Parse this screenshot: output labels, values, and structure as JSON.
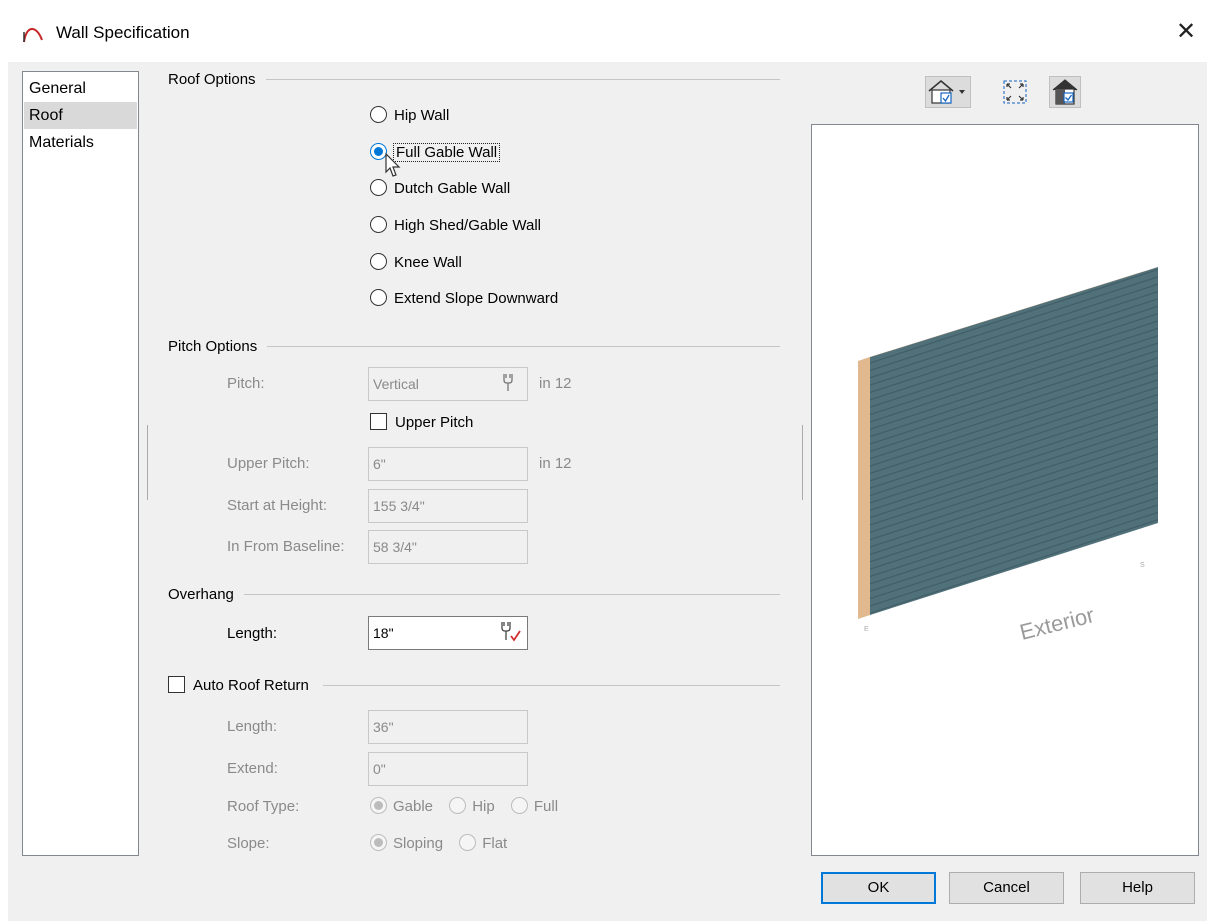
{
  "window": {
    "title": "Wall Specification",
    "close_glyph": "✕"
  },
  "nav": {
    "items": [
      {
        "label": "General",
        "selected": false
      },
      {
        "label": "Roof",
        "selected": true
      },
      {
        "label": "Materials",
        "selected": false
      }
    ]
  },
  "roof_options": {
    "title": "Roof Options",
    "options": [
      {
        "label": "Hip Wall",
        "checked": false
      },
      {
        "label": "Full Gable Wall",
        "checked": true
      },
      {
        "label": "Dutch Gable Wall",
        "checked": false
      },
      {
        "label": "High Shed/Gable Wall",
        "checked": false
      },
      {
        "label": "Knee Wall",
        "checked": false
      },
      {
        "label": "Extend Slope Downward",
        "checked": false
      }
    ]
  },
  "pitch_options": {
    "title": "Pitch Options",
    "pitch_label": "Pitch:",
    "pitch_value": "Vertical",
    "pitch_unit": "in 12",
    "upper_pitch_checkbox": "Upper Pitch",
    "upper_pitch_label": "Upper Pitch:",
    "upper_pitch_value": "6\"",
    "upper_pitch_unit": "in 12",
    "start_height_label": "Start at Height:",
    "start_height_value": "155 3/4\"",
    "in_from_baseline_label": "In From Baseline:",
    "in_from_baseline_value": "58 3/4\""
  },
  "overhang": {
    "title": "Overhang",
    "length_label": "Length:",
    "length_value": "18\""
  },
  "auto_roof_return": {
    "title": "Auto Roof Return",
    "length_label": "Length:",
    "length_value": "36\"",
    "extend_label": "Extend:",
    "extend_value": "0\"",
    "roof_type_label": "Roof Type:",
    "roof_type_options": [
      "Gable",
      "Hip",
      "Full"
    ],
    "slope_label": "Slope:",
    "slope_options": [
      "Sloping",
      "Flat"
    ]
  },
  "preview": {
    "label": "Exterior"
  },
  "buttons": {
    "ok": "OK",
    "cancel": "Cancel",
    "help": "Help"
  },
  "colors": {
    "accent": "#0078d7",
    "wall_siding": "#4f6f78",
    "wall_edge": "#e2b98f"
  }
}
